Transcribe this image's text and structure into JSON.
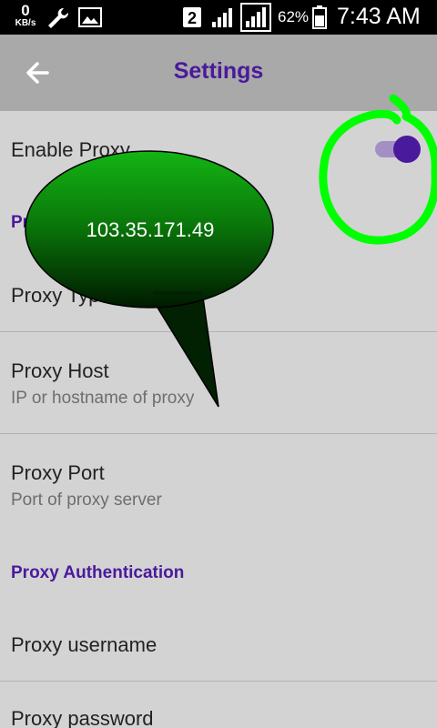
{
  "status_bar": {
    "net_speed_value": "0",
    "net_speed_unit": "KB/s",
    "sim_slot": "2",
    "battery_percent": "62%",
    "time": "7:43 AM"
  },
  "toolbar": {
    "back_icon": "arrow-left-icon",
    "title": "Settings"
  },
  "preferences": {
    "enable_proxy": {
      "title": "Enable Proxy",
      "enabled": true
    },
    "proxy_category": {
      "title": "Pr"
    },
    "proxy_type": {
      "title": "Proxy Typ"
    },
    "proxy_host": {
      "title": "Proxy Host",
      "summary": "IP or hostname of proxy"
    },
    "proxy_port": {
      "title": "Proxy Port",
      "summary": "Port of proxy server"
    },
    "auth_category": {
      "title": "Proxy Authentication"
    },
    "proxy_username": {
      "title": "Proxy username"
    },
    "proxy_password": {
      "title": "Proxy password"
    }
  },
  "annotation": {
    "bubble_text": "103.35.171.49",
    "bubble_color": "#0a7a0a",
    "circle_color": "#00ff00"
  },
  "colors": {
    "accent": "#4a1a9c",
    "toolbar_bg": "#a9a9a9",
    "page_bg": "#d3d3d3",
    "status_bar_bg": "#000000"
  }
}
